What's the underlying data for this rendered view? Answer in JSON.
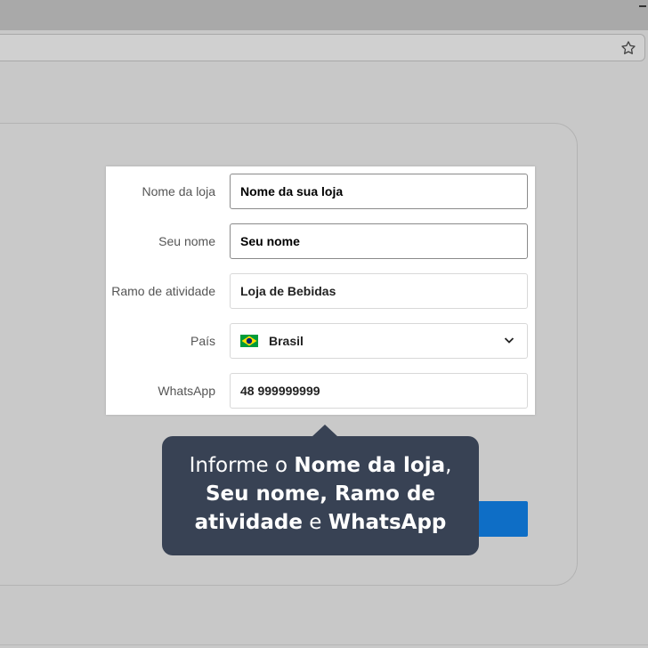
{
  "form": {
    "store_name": {
      "label": "Nome da loja",
      "value": "Nome da sua loja"
    },
    "your_name": {
      "label": "Seu nome",
      "value": "Seu nome"
    },
    "business": {
      "label": "Ramo de atividade",
      "value": "Loja de Bebidas"
    },
    "country": {
      "label": "País",
      "value": "Brasil",
      "flag_icon": "brazil-flag-icon",
      "dropdown_icon": "chevron-down-icon"
    },
    "whatsapp": {
      "label": "WhatsApp",
      "value": "48 999999999"
    }
  },
  "tooltip": {
    "p1": "Informe o ",
    "b1": "Nome da loja",
    "p2": ",",
    "b2": "Seu nome, Ramo de",
    "b3": "atividade",
    "p3": " e ",
    "b4": "WhatsApp"
  },
  "browser": {
    "bookmark_icon": "star-icon"
  },
  "colors": {
    "tooltip_bg": "#384254",
    "accent_blue": "#0e6ec6",
    "brazil_green": "#009c3b",
    "brazil_yellow": "#ffdf00",
    "brazil_blue": "#002776"
  }
}
